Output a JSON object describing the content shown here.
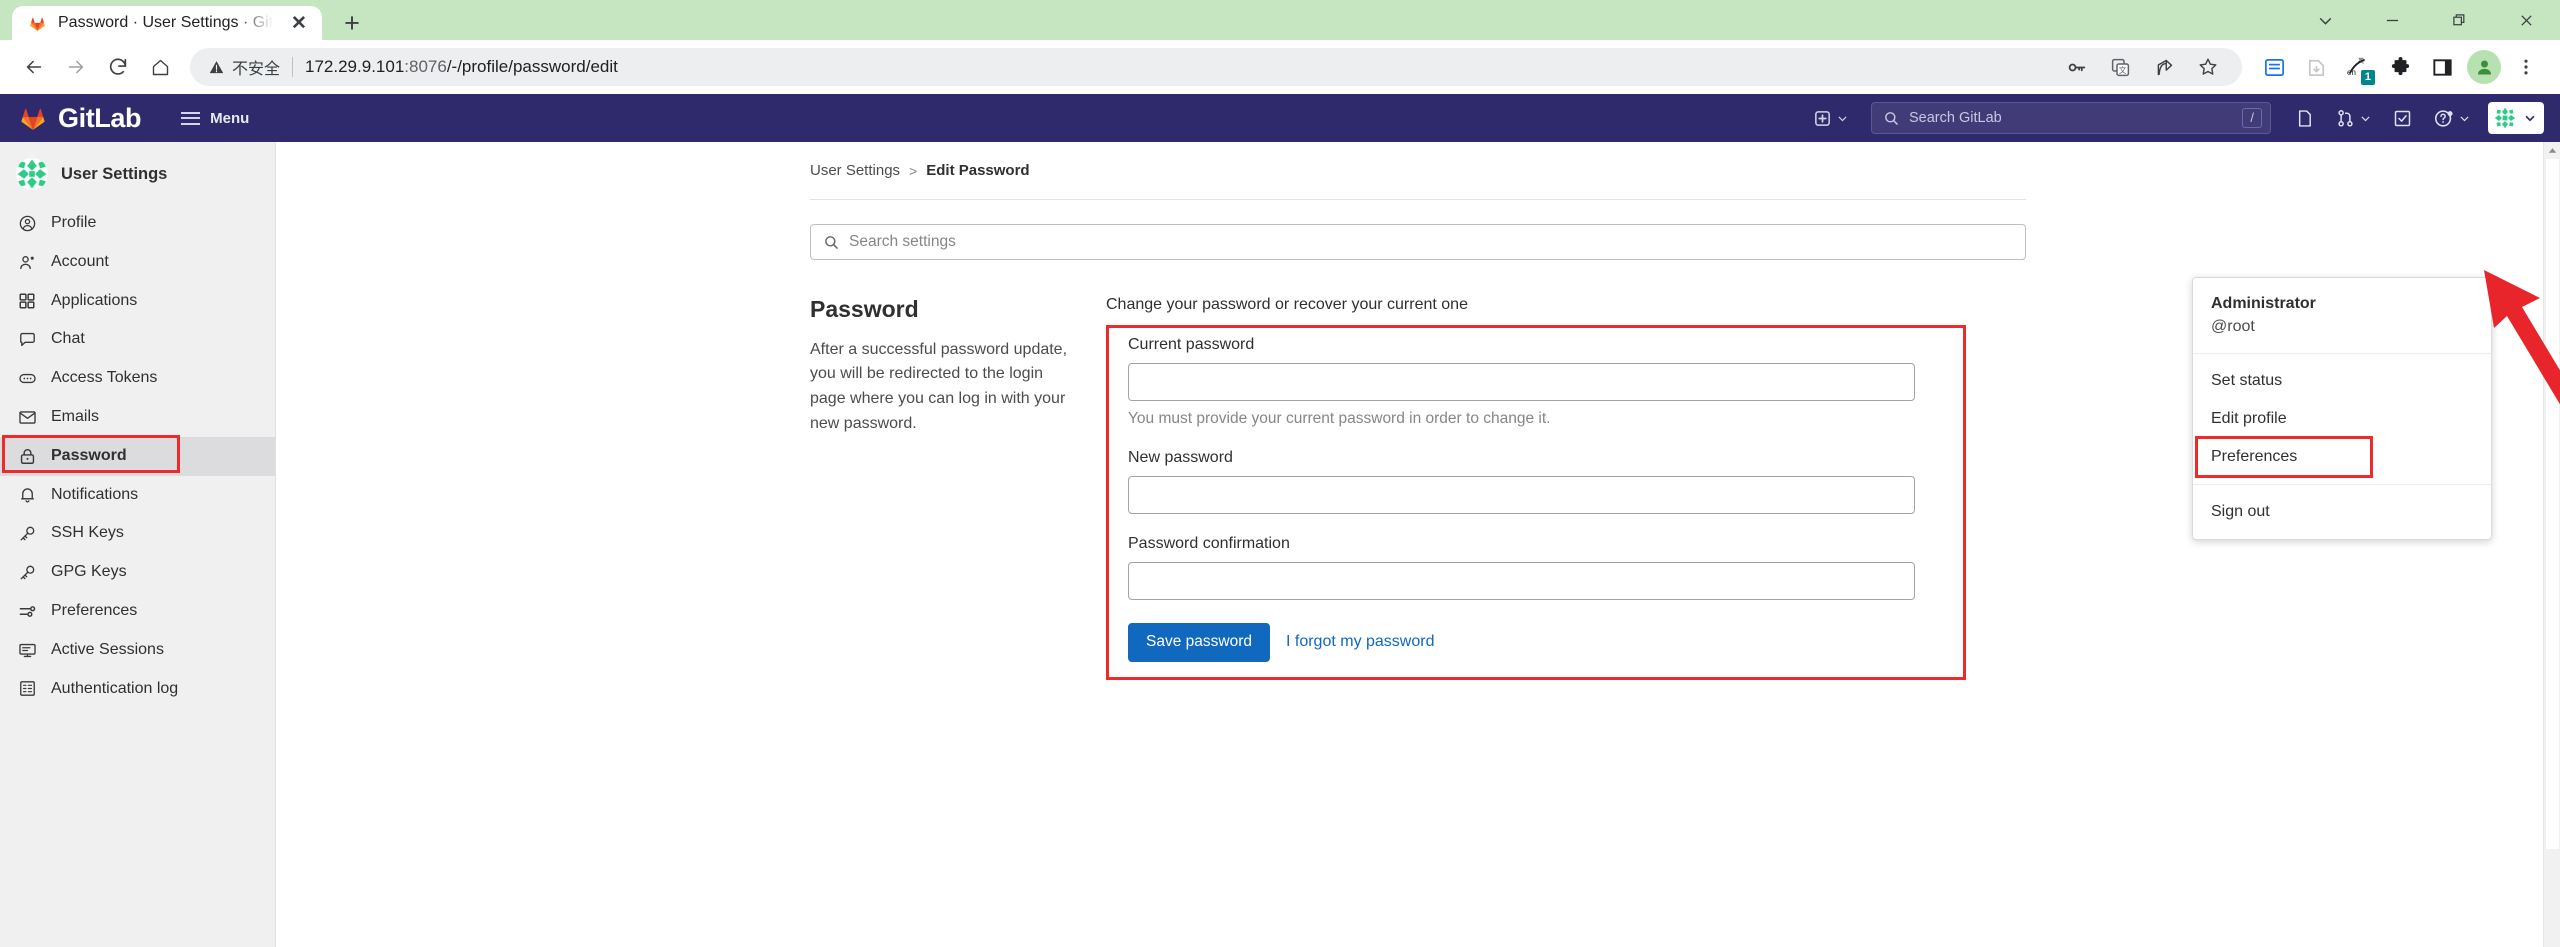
{
  "browser": {
    "tab": {
      "title": "Password · User Settings · GitLab",
      "favicon": "gitlab-fox-icon",
      "close_label": "✕"
    },
    "new_tab_label": "+",
    "window_controls": [
      "chevron-down",
      "minimize",
      "restore",
      "close"
    ],
    "nav": {
      "back": "←",
      "forward": "→",
      "reload": "⟳",
      "home": "⌂"
    },
    "omnibox": {
      "security_label": "不安全",
      "security_icon": "warning-triangle-icon",
      "url_host": "172.29.9.101",
      "url_port": ":8076",
      "url_path": "/-/profile/password/edit",
      "url_full": "172.29.9.101:8076/-/profile/password/edit",
      "inline_icons": [
        "password-key-icon",
        "translate-icon",
        "share-icon",
        "bookmark-star-icon"
      ]
    },
    "toolbar_icons": [
      "reading-list-icon",
      "downloads-icon",
      "translate-en-icon",
      "extensions-puzzle-icon",
      "side-panel-icon",
      "profile-avatar-icon",
      "chrome-menu-icon"
    ],
    "extension_badge": "1"
  },
  "gitlab": {
    "brand": "GitLab",
    "menu_label": "Menu",
    "search_placeholder": "Search GitLab",
    "search_shortcut": "/",
    "nav_icons": [
      "new-item-plus-icon",
      "issues-icon",
      "merge-requests-icon",
      "todos-icon",
      "help-icon",
      "user-avatar-icon"
    ]
  },
  "user_dropdown": {
    "name": "Administrator",
    "handle": "@root",
    "items": [
      {
        "label": "Set status",
        "highlighted": false
      },
      {
        "label": "Edit profile",
        "highlighted": false
      },
      {
        "label": "Preferences",
        "highlighted": true
      },
      {
        "label": "Sign out",
        "highlighted": false
      }
    ]
  },
  "sidebar": {
    "title": "User Settings",
    "avatar": "user-identicon",
    "items": [
      {
        "label": "Profile",
        "icon": "profile-icon",
        "active": false
      },
      {
        "label": "Account",
        "icon": "account-icon",
        "active": false
      },
      {
        "label": "Applications",
        "icon": "applications-grid-icon",
        "active": false
      },
      {
        "label": "Chat",
        "icon": "chat-bubble-icon",
        "active": false
      },
      {
        "label": "Access Tokens",
        "icon": "token-icon",
        "active": false
      },
      {
        "label": "Emails",
        "icon": "envelope-icon",
        "active": false
      },
      {
        "label": "Password",
        "icon": "lock-icon",
        "active": true
      },
      {
        "label": "Notifications",
        "icon": "bell-icon",
        "active": false
      },
      {
        "label": "SSH Keys",
        "icon": "key-icon",
        "active": false
      },
      {
        "label": "GPG Keys",
        "icon": "key-icon",
        "active": false
      },
      {
        "label": "Preferences",
        "icon": "sliders-icon",
        "active": false
      },
      {
        "label": "Active Sessions",
        "icon": "monitor-icon",
        "active": false
      },
      {
        "label": "Authentication log",
        "icon": "log-list-icon",
        "active": false
      }
    ]
  },
  "breadcrumb": {
    "parent": "User Settings",
    "separator": ">",
    "current": "Edit Password"
  },
  "settings_search": {
    "placeholder": "Search settings",
    "icon": "search-icon"
  },
  "password_section": {
    "title": "Password",
    "description": "After a successful password update, you will be redirected to the login page where you can log in with your new password.",
    "form_legend": "Change your password or recover your current one",
    "fields": [
      {
        "label": "Current password",
        "value": "",
        "help": "You must provide your current password in order to change it."
      },
      {
        "label": "New password",
        "value": "",
        "help": ""
      },
      {
        "label": "Password confirmation",
        "value": "",
        "help": ""
      }
    ],
    "submit_label": "Save password",
    "forgot_link": "I forgot my password"
  },
  "annotations": {
    "highlight_color": "#ee2b2b",
    "arrow_color": "#e8252a",
    "arrow_target": "user-avatar-dropdown"
  },
  "colors": {
    "gitlab_navy": "#2f2a6b",
    "titlebar_green": "#c5e6c0",
    "primary_blue": "#1068bf",
    "sidebar_grey": "#f0f0f0",
    "active_item_grey": "#dcdcde"
  }
}
